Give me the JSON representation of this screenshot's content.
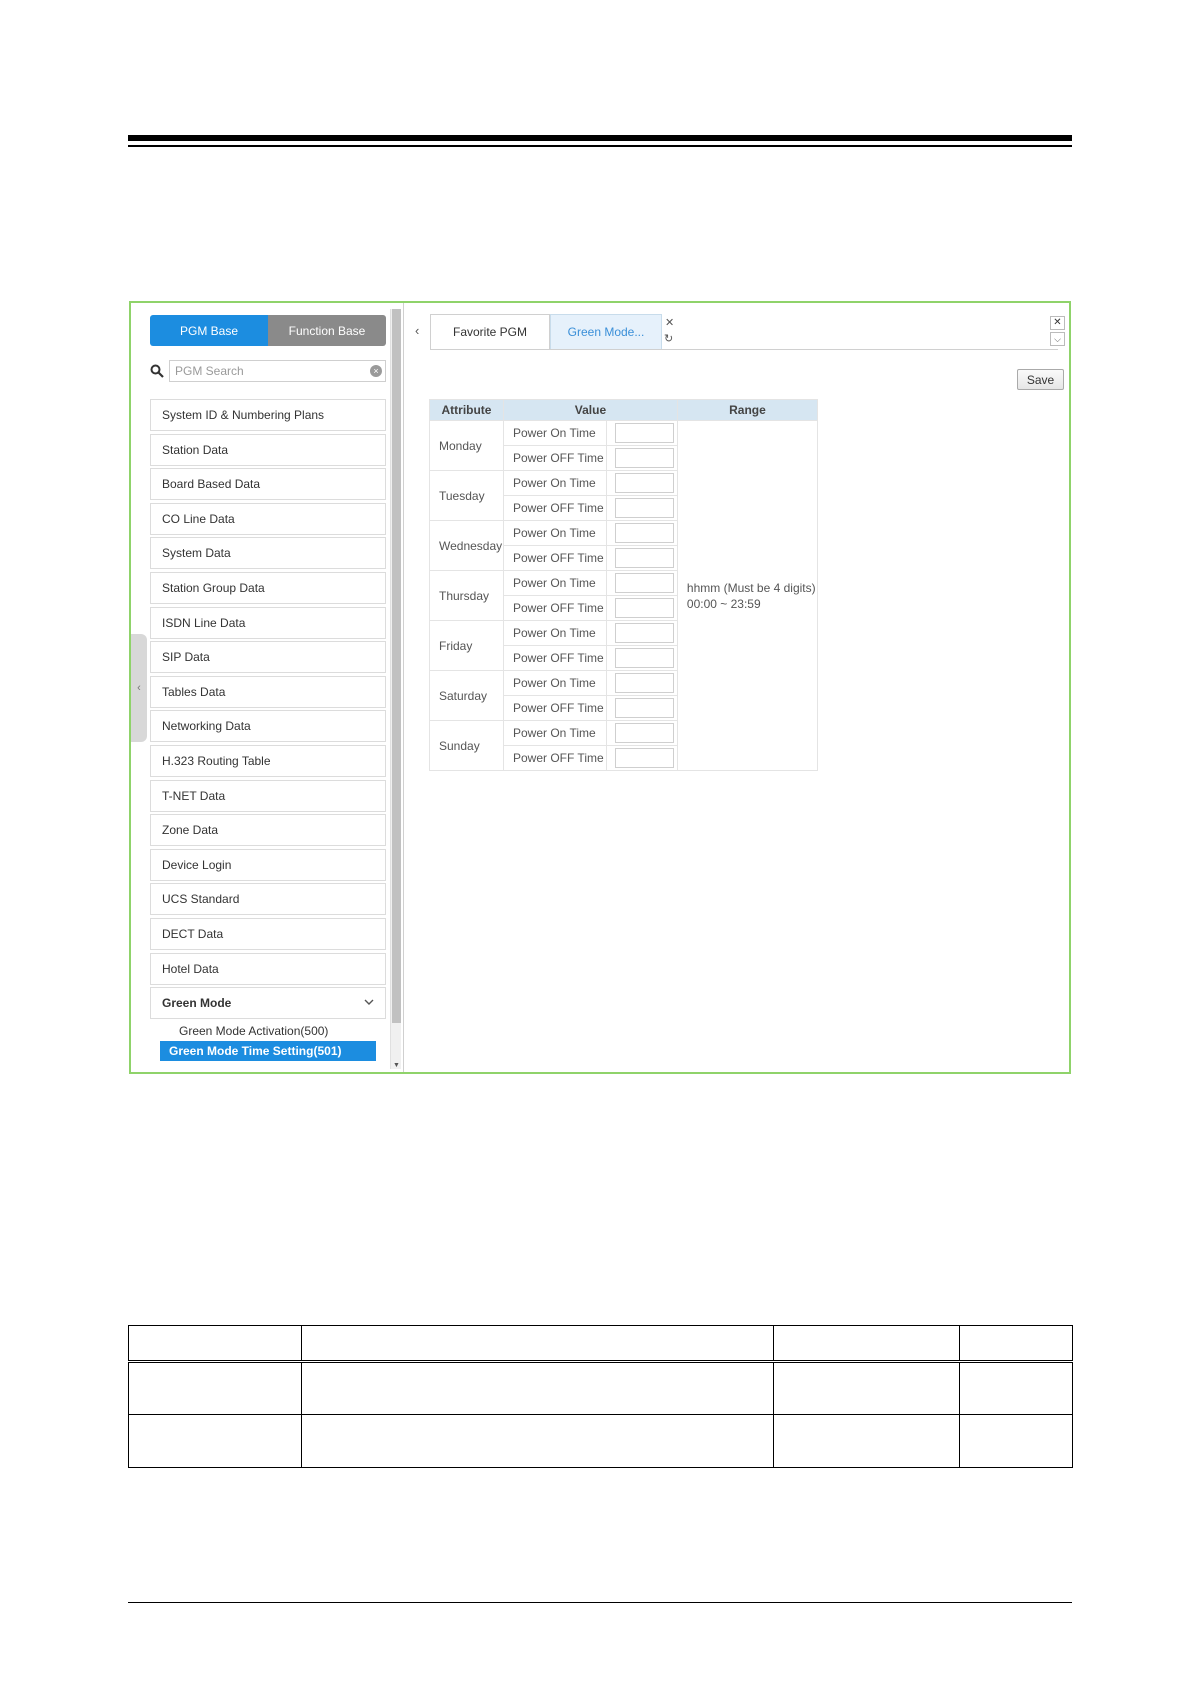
{
  "page": {
    "app": {
      "mode_tabs": [
        {
          "label": "PGM Base",
          "active": true
        },
        {
          "label": "Function Base",
          "active": false
        }
      ],
      "search": {
        "placeholder": "PGM Search",
        "value": ""
      },
      "menu_items": [
        "System ID & Numbering Plans",
        "Station Data",
        "Board Based Data",
        "CO Line Data",
        "System Data",
        "Station Group Data",
        "ISDN Line Data",
        "SIP Data",
        "Tables Data",
        "Networking Data",
        "H.323 Routing Table",
        "T-NET Data",
        "Zone Data",
        "Device Login",
        "UCS Standard",
        "DECT Data",
        "Hotel Data",
        "Green Mode"
      ],
      "expanded_menu": "Green Mode",
      "submenu_items": [
        {
          "label": "Green Mode Activation(500)",
          "active": false
        },
        {
          "label": "Green Mode Time Setting(501)",
          "active": true
        }
      ],
      "tabs": [
        {
          "label": "Favorite PGM",
          "active": false
        },
        {
          "label": "Green Mode...",
          "active": true
        }
      ],
      "save_label": "Save",
      "table": {
        "headers": [
          "Attribute",
          "Value",
          "Range"
        ],
        "days": [
          "Monday",
          "Tuesday",
          "Wednesday",
          "Thursday",
          "Friday",
          "Saturday",
          "Sunday"
        ],
        "row_labels": [
          "Power On Time",
          "Power OFF Time"
        ],
        "range_line1": "hhmm (Must be 4 digits)",
        "range_line2": "00:00 ~ 23:59"
      }
    },
    "colors": {
      "accent": "#1c8de0",
      "frame_border": "#8fd36a",
      "table_header": "#d6e6f2"
    }
  }
}
